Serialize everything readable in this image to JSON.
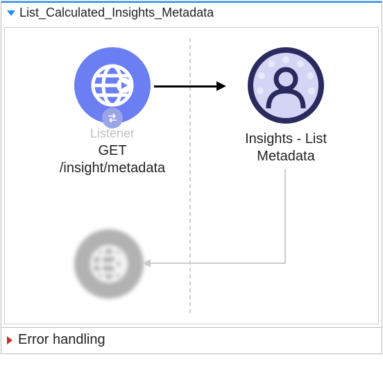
{
  "header": {
    "title": "List_Calculated_Insights_Metadata"
  },
  "nodes": {
    "listener": {
      "label": "Listener",
      "sublabel": "GET /insight/metadata"
    },
    "insights": {
      "sublabel": "Insights - List Metadata"
    }
  },
  "errorSection": {
    "label": "Error handling"
  }
}
